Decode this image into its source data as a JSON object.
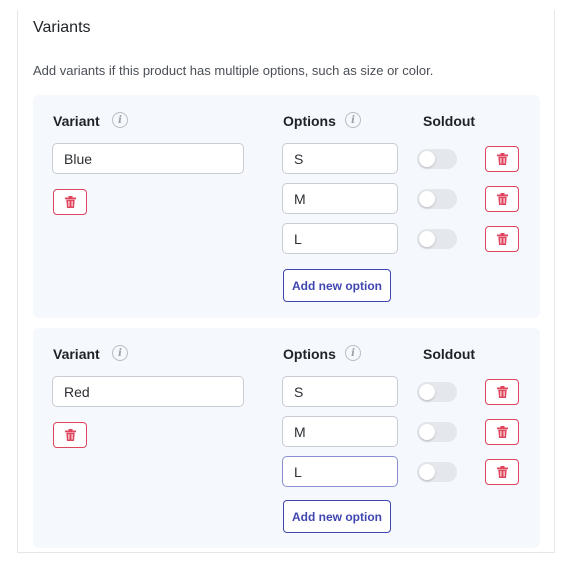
{
  "section": {
    "title": "Variants",
    "description": "Add variants if this product has multiple options, such as size or color."
  },
  "labels": {
    "variant": "Variant",
    "options": "Options",
    "soldout": "Soldout",
    "add_option": "Add new option",
    "info_glyph": "i"
  },
  "variants": [
    {
      "value": "Blue",
      "options": [
        {
          "value": "S",
          "soldout": false
        },
        {
          "value": "M",
          "soldout": false
        },
        {
          "value": "L",
          "soldout": false
        }
      ]
    },
    {
      "value": "Red",
      "options": [
        {
          "value": "S",
          "soldout": false
        },
        {
          "value": "M",
          "soldout": false
        },
        {
          "value": "L",
          "soldout": false
        }
      ]
    }
  ],
  "colors": {
    "accent": "#3f46b0",
    "danger": "#e0455e",
    "panel_bg": "#f5f8fd"
  },
  "icons": {
    "info": "info-icon",
    "delete": "trash-icon"
  }
}
